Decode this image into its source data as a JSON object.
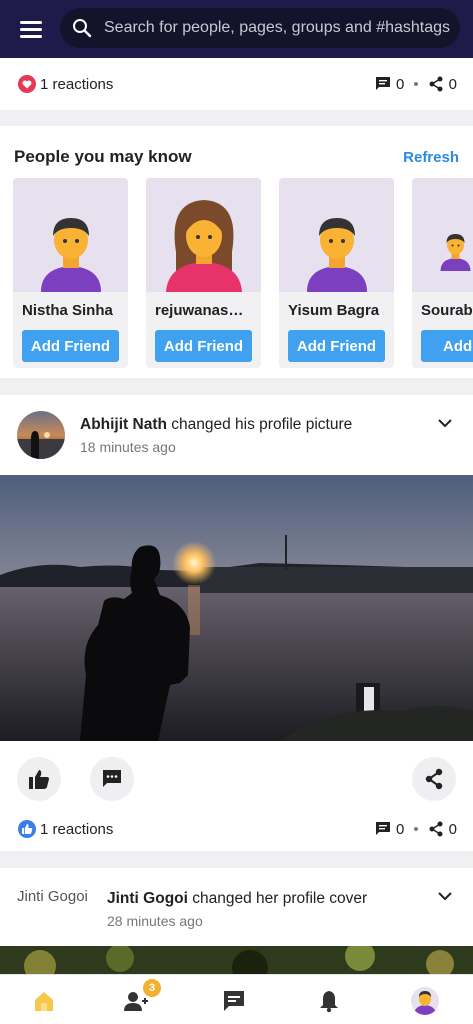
{
  "header": {
    "search_placeholder": "Search for people, pages, groups and #hashtags"
  },
  "post_top": {
    "reactions": "1 reactions",
    "comments": "0",
    "shares": "0"
  },
  "pymk": {
    "title": "People you may know",
    "refresh": "Refresh",
    "people": [
      {
        "name": "Nistha Sinha",
        "button": "Add Friend"
      },
      {
        "name": "rejuwanasul...",
        "button": "Add Friend"
      },
      {
        "name": "Yisum Bagra",
        "button": "Add Friend"
      },
      {
        "name": "Sourab",
        "button": "Add Friend"
      }
    ]
  },
  "post1": {
    "author": "Abhijit Nath",
    "action": " changed his profile picture",
    "time": "18 minutes ago",
    "reactions": "1 reactions",
    "comments": "0",
    "shares": "0"
  },
  "post2": {
    "avatar_alt": "Jinti Gogoi",
    "author": "Jinti Gogoi",
    "action": " changed her profile cover",
    "time": "28 minutes ago"
  },
  "bottom_nav": {
    "friend_requests_badge": "3"
  },
  "colors": {
    "header_bg": "#1e1a4a",
    "accent": "#2a8be0",
    "button": "#3fa1ef",
    "badge": "#f2b231",
    "heart": "#e53955"
  }
}
